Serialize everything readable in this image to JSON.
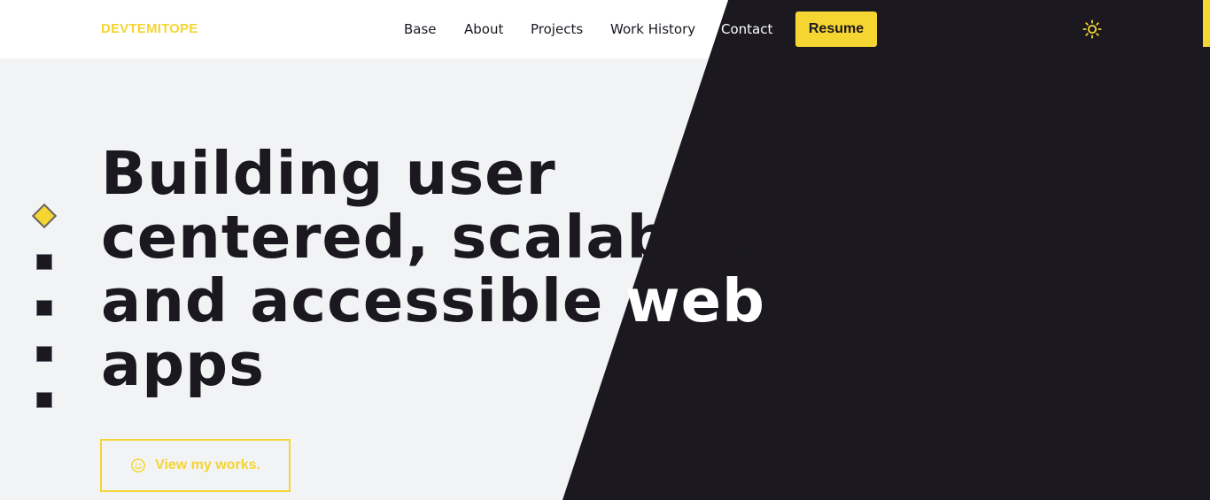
{
  "header": {
    "logo": "DEVTEMITOPE",
    "nav": [
      "Base",
      "About",
      "Projects",
      "Work History",
      "Contact"
    ],
    "resume_label": "Resume",
    "theme_icon": "sun-icon"
  },
  "hero": {
    "headline_lines": [
      "Building user",
      "centered, scalable,",
      "and accessible web",
      "apps"
    ],
    "cta_label": "View my works.",
    "cta_icon": "smiley-icon",
    "section_indicators": {
      "count": 5,
      "active_index": 0
    }
  },
  "colors": {
    "accent": "#f5d531",
    "dark": "#1b1820",
    "light_bg": "#f2f3f5"
  }
}
